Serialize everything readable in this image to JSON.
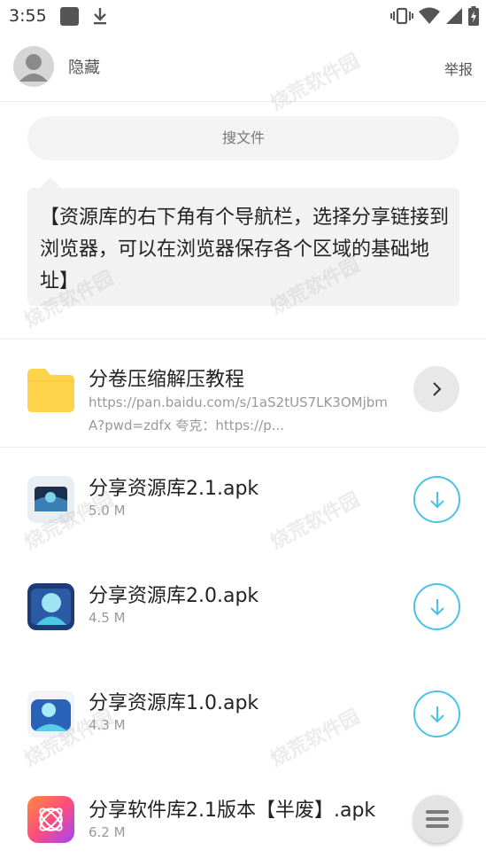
{
  "status": {
    "time": "3:55"
  },
  "header": {
    "username": "隐藏",
    "report": "举报"
  },
  "search": {
    "placeholder": "搜文件"
  },
  "notice": {
    "text": "【资源库的右下角有个导航栏，选择分享链接到浏览器，可以在浏览器保存各个区域的基础地址】"
  },
  "folder": {
    "name": "分卷压缩解压教程",
    "desc_line1": "https://pan.baidu.com/s/1aS2tUS7LK3OMjbm",
    "desc_line2": "A?pwd=zdfx 夸克：https://p..."
  },
  "files": [
    {
      "name": "分享资源库2.1.apk",
      "size": "5.0 M"
    },
    {
      "name": "分享资源库2.0.apk",
      "size": "4.5 M"
    },
    {
      "name": "分享资源库1.0.apk",
      "size": "4.3 M"
    },
    {
      "name": "分享软件库2.1版本【半废】.apk",
      "size": "6.2 M"
    }
  ],
  "watermark": "烧荒软件园",
  "colors": {
    "accent": "#49c3e8",
    "folder": "#fdd34b"
  }
}
